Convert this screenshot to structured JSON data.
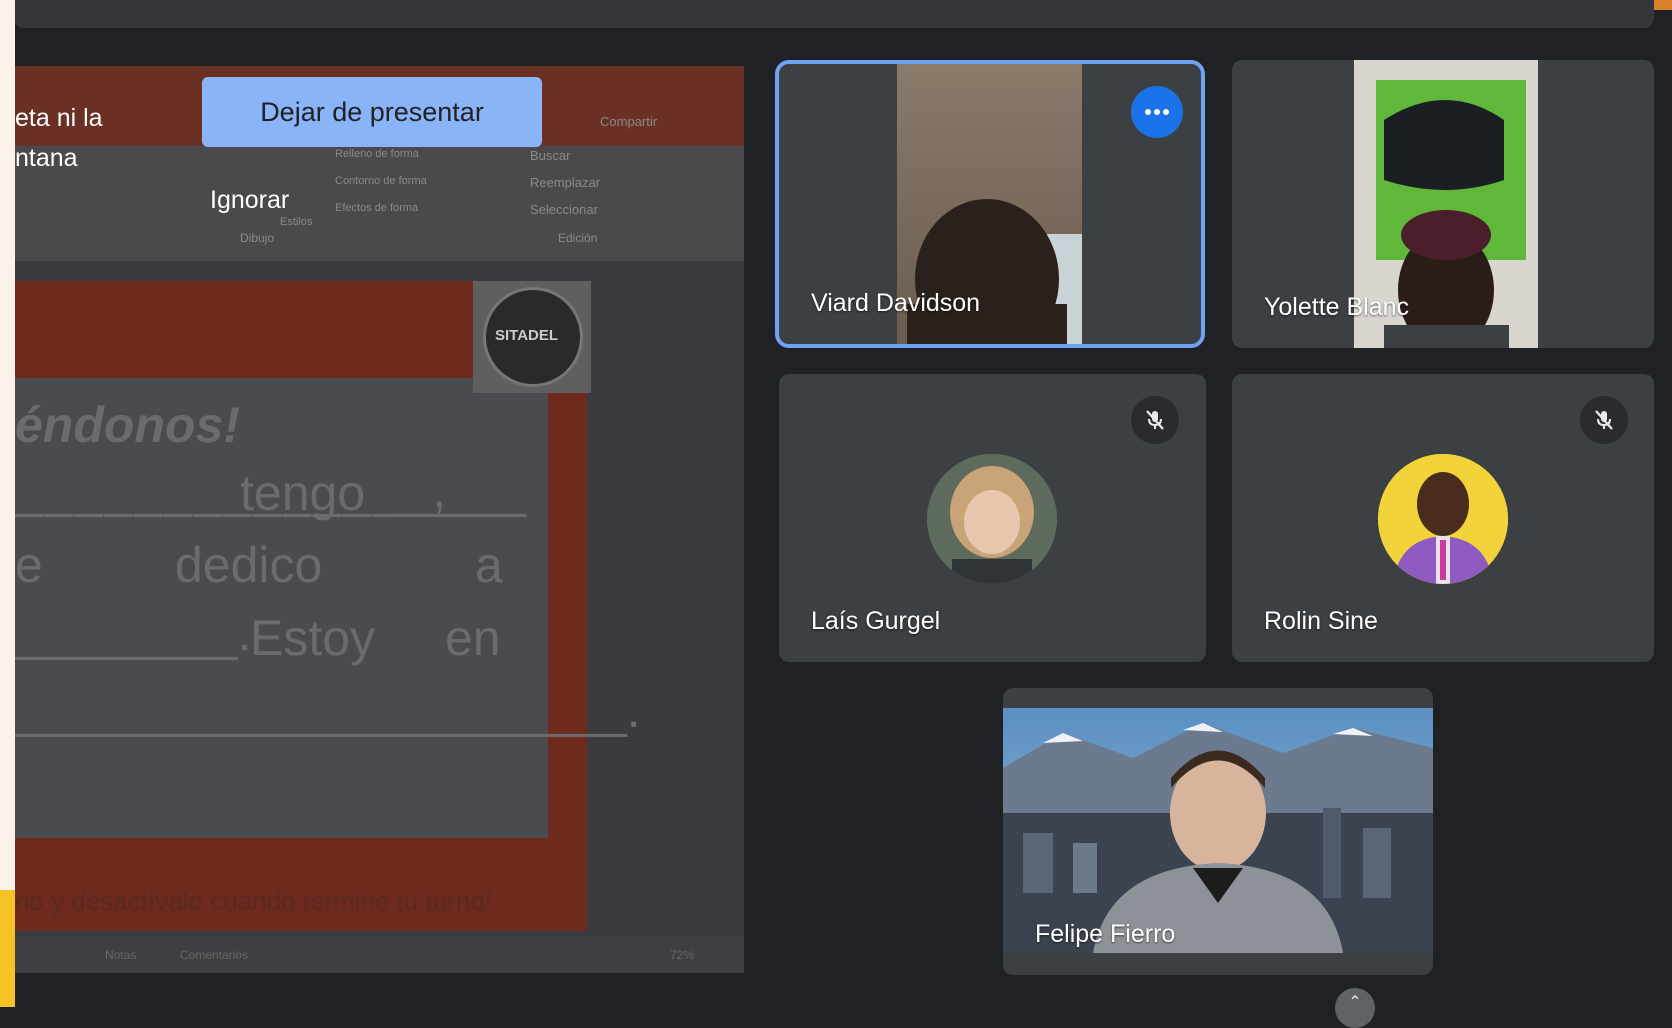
{
  "presentation": {
    "stop_presenting_label": "Dejar de presentar",
    "ignore_label": "Ignorar",
    "notice_line1": "eta ni la",
    "notice_line2": "ntana",
    "ribbon": {
      "share": "Compartir",
      "search": "Buscar",
      "replace": "Reemplazar",
      "select": "Seleccionar",
      "group_drawing": "Dibujo",
      "group_editing": "Edición",
      "fill": "Relleno de forma",
      "outline": "Contorno de forma",
      "effects": "Efectos de forma",
      "styles": "Estilos"
    },
    "slide": {
      "heading": "éndonos!",
      "line1_word": "tengo",
      "line2_a": "e",
      "line2_b": "dedico",
      "line2_c": "a",
      "line3_word": "Estoy",
      "line3_end": "en",
      "footer": "no y desactívalo cuando termine tu turno!",
      "logo_text": "SITADEL"
    },
    "status": {
      "notes": "Notas",
      "comments": "Comentarios",
      "zoom": "72%"
    }
  },
  "participants": [
    {
      "name": "Viard Davidson",
      "muted": false,
      "active": true
    },
    {
      "name": "Yolette Blanc",
      "muted": false,
      "active": false
    },
    {
      "name": "Laís Gurgel",
      "muted": true,
      "active": false
    },
    {
      "name": "Rolin Sine",
      "muted": true,
      "active": false
    },
    {
      "name": "Felipe Fierro",
      "muted": false,
      "active": false
    }
  ],
  "colors": {
    "accent": "#8ab4f8",
    "active_outline": "#6fa1f5",
    "more_button": "#1a73e8",
    "tile_bg": "#3c4043",
    "page_bg": "#202124",
    "brand_strip": "#d9822b"
  },
  "icons": {
    "more": "more-horiz-icon",
    "mic_off": "mic-off-icon"
  }
}
